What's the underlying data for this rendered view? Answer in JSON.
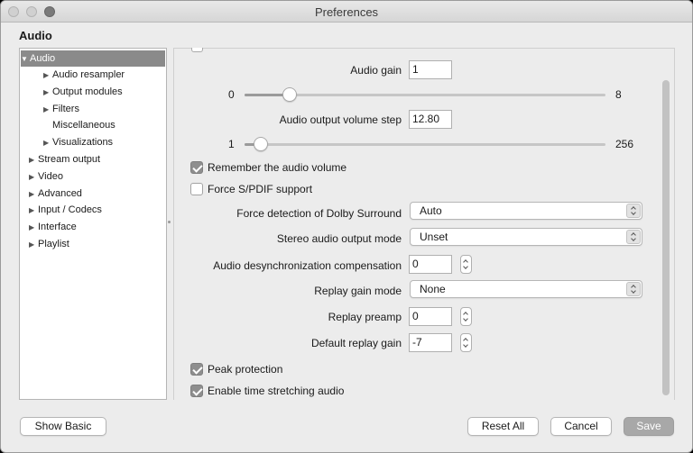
{
  "window": {
    "title": "Preferences"
  },
  "section": {
    "title": "Audio"
  },
  "tree": {
    "items": [
      {
        "label": "Audio",
        "expanded": true,
        "selected": true
      },
      {
        "label": "Audio resampler"
      },
      {
        "label": "Output modules"
      },
      {
        "label": "Filters"
      },
      {
        "label": "Miscellaneous"
      },
      {
        "label": "Visualizations"
      },
      {
        "label": "Stream output"
      },
      {
        "label": "Video"
      },
      {
        "label": "Advanced"
      },
      {
        "label": "Input / Codecs"
      },
      {
        "label": "Interface"
      },
      {
        "label": "Playlist"
      }
    ]
  },
  "settings": {
    "audio_gain": {
      "label": "Audio gain",
      "value": "1",
      "min_label": "0",
      "max_label": "8",
      "level": 0.125
    },
    "volume_step": {
      "label": "Audio output volume step",
      "value": "12.80",
      "min_label": "1",
      "max_label": "256",
      "level": 0.046
    },
    "remember_volume": {
      "label": "Remember the audio volume",
      "checked": true
    },
    "force_spdif": {
      "label": "Force S/PDIF support",
      "checked": false
    },
    "dolby": {
      "label": "Force detection of Dolby Surround",
      "value": "Auto"
    },
    "stereo_mode": {
      "label": "Stereo audio output mode",
      "value": "Unset"
    },
    "desync": {
      "label": "Audio desynchronization compensation",
      "value": "0"
    },
    "replay_gain_mode": {
      "label": "Replay gain mode",
      "value": "None"
    },
    "replay_preamp": {
      "label": "Replay preamp",
      "value": "0"
    },
    "default_replay_gain": {
      "label": "Default replay gain",
      "value": "-7"
    },
    "peak_protection": {
      "label": "Peak protection",
      "checked": true
    },
    "time_stretching": {
      "label": "Enable time stretching audio",
      "checked": true
    }
  },
  "buttons": {
    "show_basic": "Show Basic",
    "reset_all": "Reset All",
    "cancel": "Cancel",
    "save": "Save"
  },
  "colors": {
    "selection": "#8a8a8a",
    "checkbox_on": "#8e8e8e",
    "save_disabled": "#a8a8a8"
  }
}
